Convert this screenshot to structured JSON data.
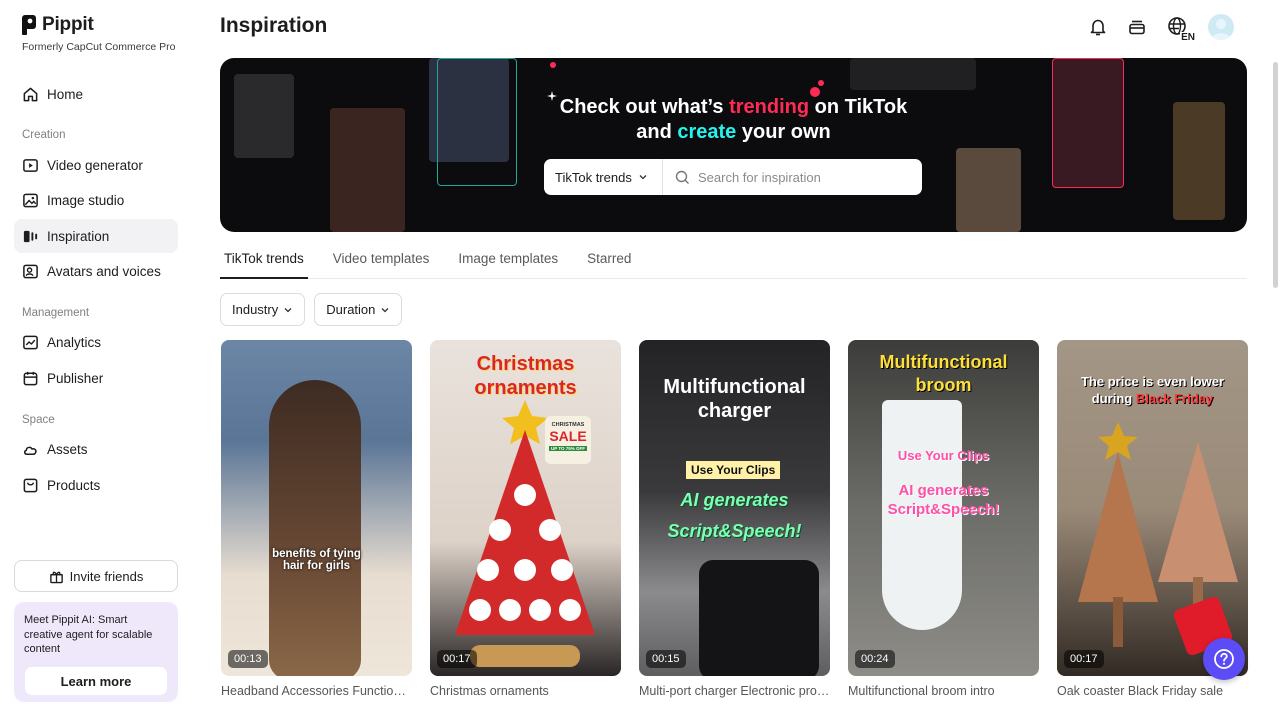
{
  "brand": {
    "name": "Pippit",
    "subtitle": "Formerly CapCut Commerce Pro"
  },
  "sidebar": {
    "home": "Home",
    "sections": [
      "Creation",
      "Management",
      "Space"
    ],
    "creation": [
      {
        "label": "Video generator",
        "icon": "video-generator-icon"
      },
      {
        "label": "Image studio",
        "icon": "image-studio-icon"
      },
      {
        "label": "Inspiration",
        "icon": "inspiration-icon",
        "active": true
      },
      {
        "label": "Avatars and voices",
        "icon": "avatar-voice-icon"
      }
    ],
    "management": [
      {
        "label": "Analytics",
        "icon": "analytics-icon"
      },
      {
        "label": "Publisher",
        "icon": "calendar-icon"
      }
    ],
    "space": [
      {
        "label": "Assets",
        "icon": "cloud-icon"
      },
      {
        "label": "Products",
        "icon": "box-icon"
      }
    ],
    "invite_label": "Invite friends",
    "promo": {
      "title": "Meet Pippit AI: Smart creative agent for scalable content",
      "button": "Learn more"
    }
  },
  "header": {
    "title": "Inspiration",
    "language": "EN",
    "icons": [
      "bell-icon",
      "layers-icon",
      "globe-icon",
      "avatar"
    ]
  },
  "banner": {
    "line1_a": "Check out what’s ",
    "line1_highlight": "trending",
    "line1_b": " on TikTok",
    "line2_a": "and ",
    "line2_highlight": "create",
    "line2_b": " your own",
    "dropdown": "TikTok trends",
    "search_placeholder": "Search for inspiration",
    "colors": {
      "pink": "#fe2c55",
      "cyan": "#25f4ee"
    }
  },
  "tabs": [
    "TikTok trends",
    "Video templates",
    "Image templates",
    "Starred"
  ],
  "active_tab": "TikTok trends",
  "filters": [
    "Industry",
    "Duration"
  ],
  "cards": [
    {
      "title": "Headband Accessories Function Demo",
      "duration": "00:13",
      "caption": "benefits of tying hair for girls"
    },
    {
      "title": "Christmas ornaments",
      "duration": "00:17",
      "caption_1": "Christmas",
      "caption_2": "ornaments",
      "sale_1": "CHRISTMAS",
      "sale_2": "SALE",
      "sale_3": "UP TO 75% OFF"
    },
    {
      "title": "Multi-port charger Electronic product",
      "duration": "00:15",
      "caption_1": "Multifunctional",
      "caption_2": "charger",
      "caption_3": "Use Your Clips",
      "caption_4": "AI generates",
      "caption_5": "Script&Speech!"
    },
    {
      "title": "Multifunctional broom intro",
      "duration": "00:24",
      "caption_1": "Multifunctional",
      "caption_2": "broom",
      "caption_3": "Use Your Clips",
      "caption_4": "AI generates",
      "caption_5": "Script&Speech!"
    },
    {
      "title": "Oak coaster Black Friday sale",
      "duration": "00:17",
      "caption_1": "The price is even lower",
      "caption_2": "during",
      "caption_3": "Black Friday"
    }
  ]
}
